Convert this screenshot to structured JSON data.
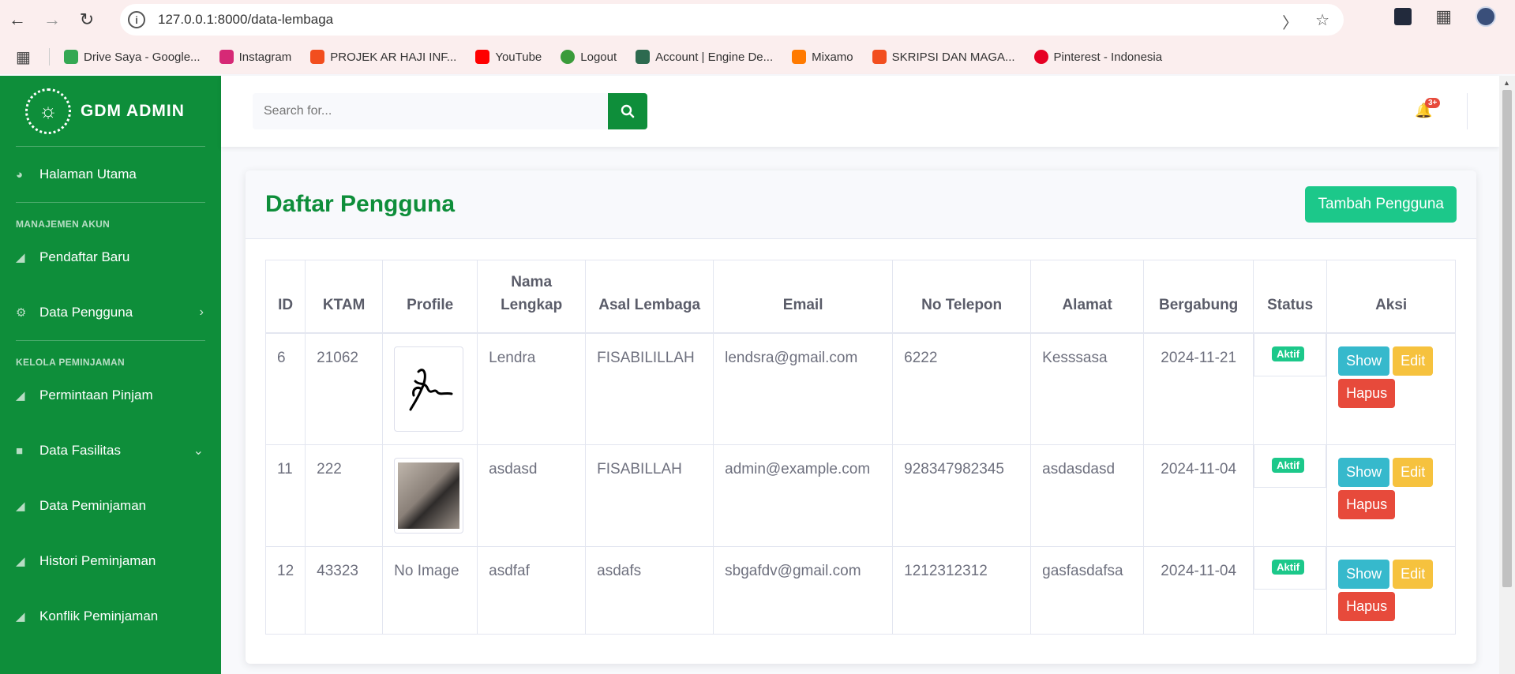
{
  "browser": {
    "url": "127.0.0.1:8000/data-lembaga",
    "bookmarks": [
      {
        "label": "Drive Saya - Google...",
        "color": "#34a853"
      },
      {
        "label": "Instagram",
        "color": "#d62976"
      },
      {
        "label": "PROJEK AR HAJI INF...",
        "color": "#f24e1e"
      },
      {
        "label": "YouTube",
        "color": "#ff0000"
      },
      {
        "label": "Logout",
        "color": "#3a9b3a"
      },
      {
        "label": "Account | Engine De...",
        "color": "#2d6a4f"
      },
      {
        "label": "Mixamo",
        "color": "#ff7a00"
      },
      {
        "label": "SKRIPSI DAN MAGA...",
        "color": "#f24e1e"
      },
      {
        "label": "Pinterest - Indonesia",
        "color": "#e60023"
      }
    ]
  },
  "sidebar": {
    "brand": "GDM ADMIN",
    "home": "Halaman Utama",
    "heading_akun": "MANAJEMEN AKUN",
    "pendaftar": "Pendaftar Baru",
    "data_pengguna": "Data Pengguna",
    "heading_pinjam": "KELOLA PEMINJAMAN",
    "permintaan": "Permintaan Pinjam",
    "fasilitas": "Data Fasilitas",
    "peminjaman": "Data Peminjaman",
    "histori": "Histori Peminjaman",
    "konflik": "Konflik Peminjaman"
  },
  "topbar": {
    "search_placeholder": "Search for...",
    "alert_count": "3+"
  },
  "page": {
    "title": "Daftar Pengguna",
    "add_button": "Tambah Pengguna"
  },
  "table": {
    "headers": [
      "ID",
      "KTAM",
      "Profile",
      "Nama Lengkap",
      "Asal Lembaga",
      "Email",
      "No Telepon",
      "Alamat",
      "Bergabung",
      "Status",
      "Aksi"
    ],
    "rows": [
      {
        "id": "6",
        "ktam": "21062",
        "profile": "signature",
        "nama": "Lendra",
        "lembaga": "FISABILILLAH",
        "email": "lendsra@gmail.com",
        "telepon": "6222",
        "alamat": "Kesssasa",
        "bergabung": "2024-11-21",
        "status": "Aktif"
      },
      {
        "id": "11",
        "ktam": "222",
        "profile": "photo",
        "nama": "asdasd",
        "lembaga": "FISABILLAH",
        "email": "admin@example.com",
        "telepon": "928347982345",
        "alamat": "asdasdasd",
        "bergabung": "2024-11-04",
        "status": "Aktif"
      },
      {
        "id": "12",
        "ktam": "43323",
        "profile": "No Image",
        "nama": "asdfaf",
        "lembaga": "asdafs",
        "email": "sbgafdv@gmail.com",
        "telepon": "1212312312",
        "alamat": "gasfasdafsa",
        "bergabung": "2024-11-04",
        "status": "Aktif"
      }
    ],
    "actions": {
      "show": "Show",
      "edit": "Edit",
      "delete": "Hapus"
    }
  },
  "colors": {
    "brand_green": "#0e8e3a",
    "success": "#1cc88a",
    "info": "#36b9cc",
    "warning": "#f6c23e",
    "danger": "#e74a3b"
  }
}
